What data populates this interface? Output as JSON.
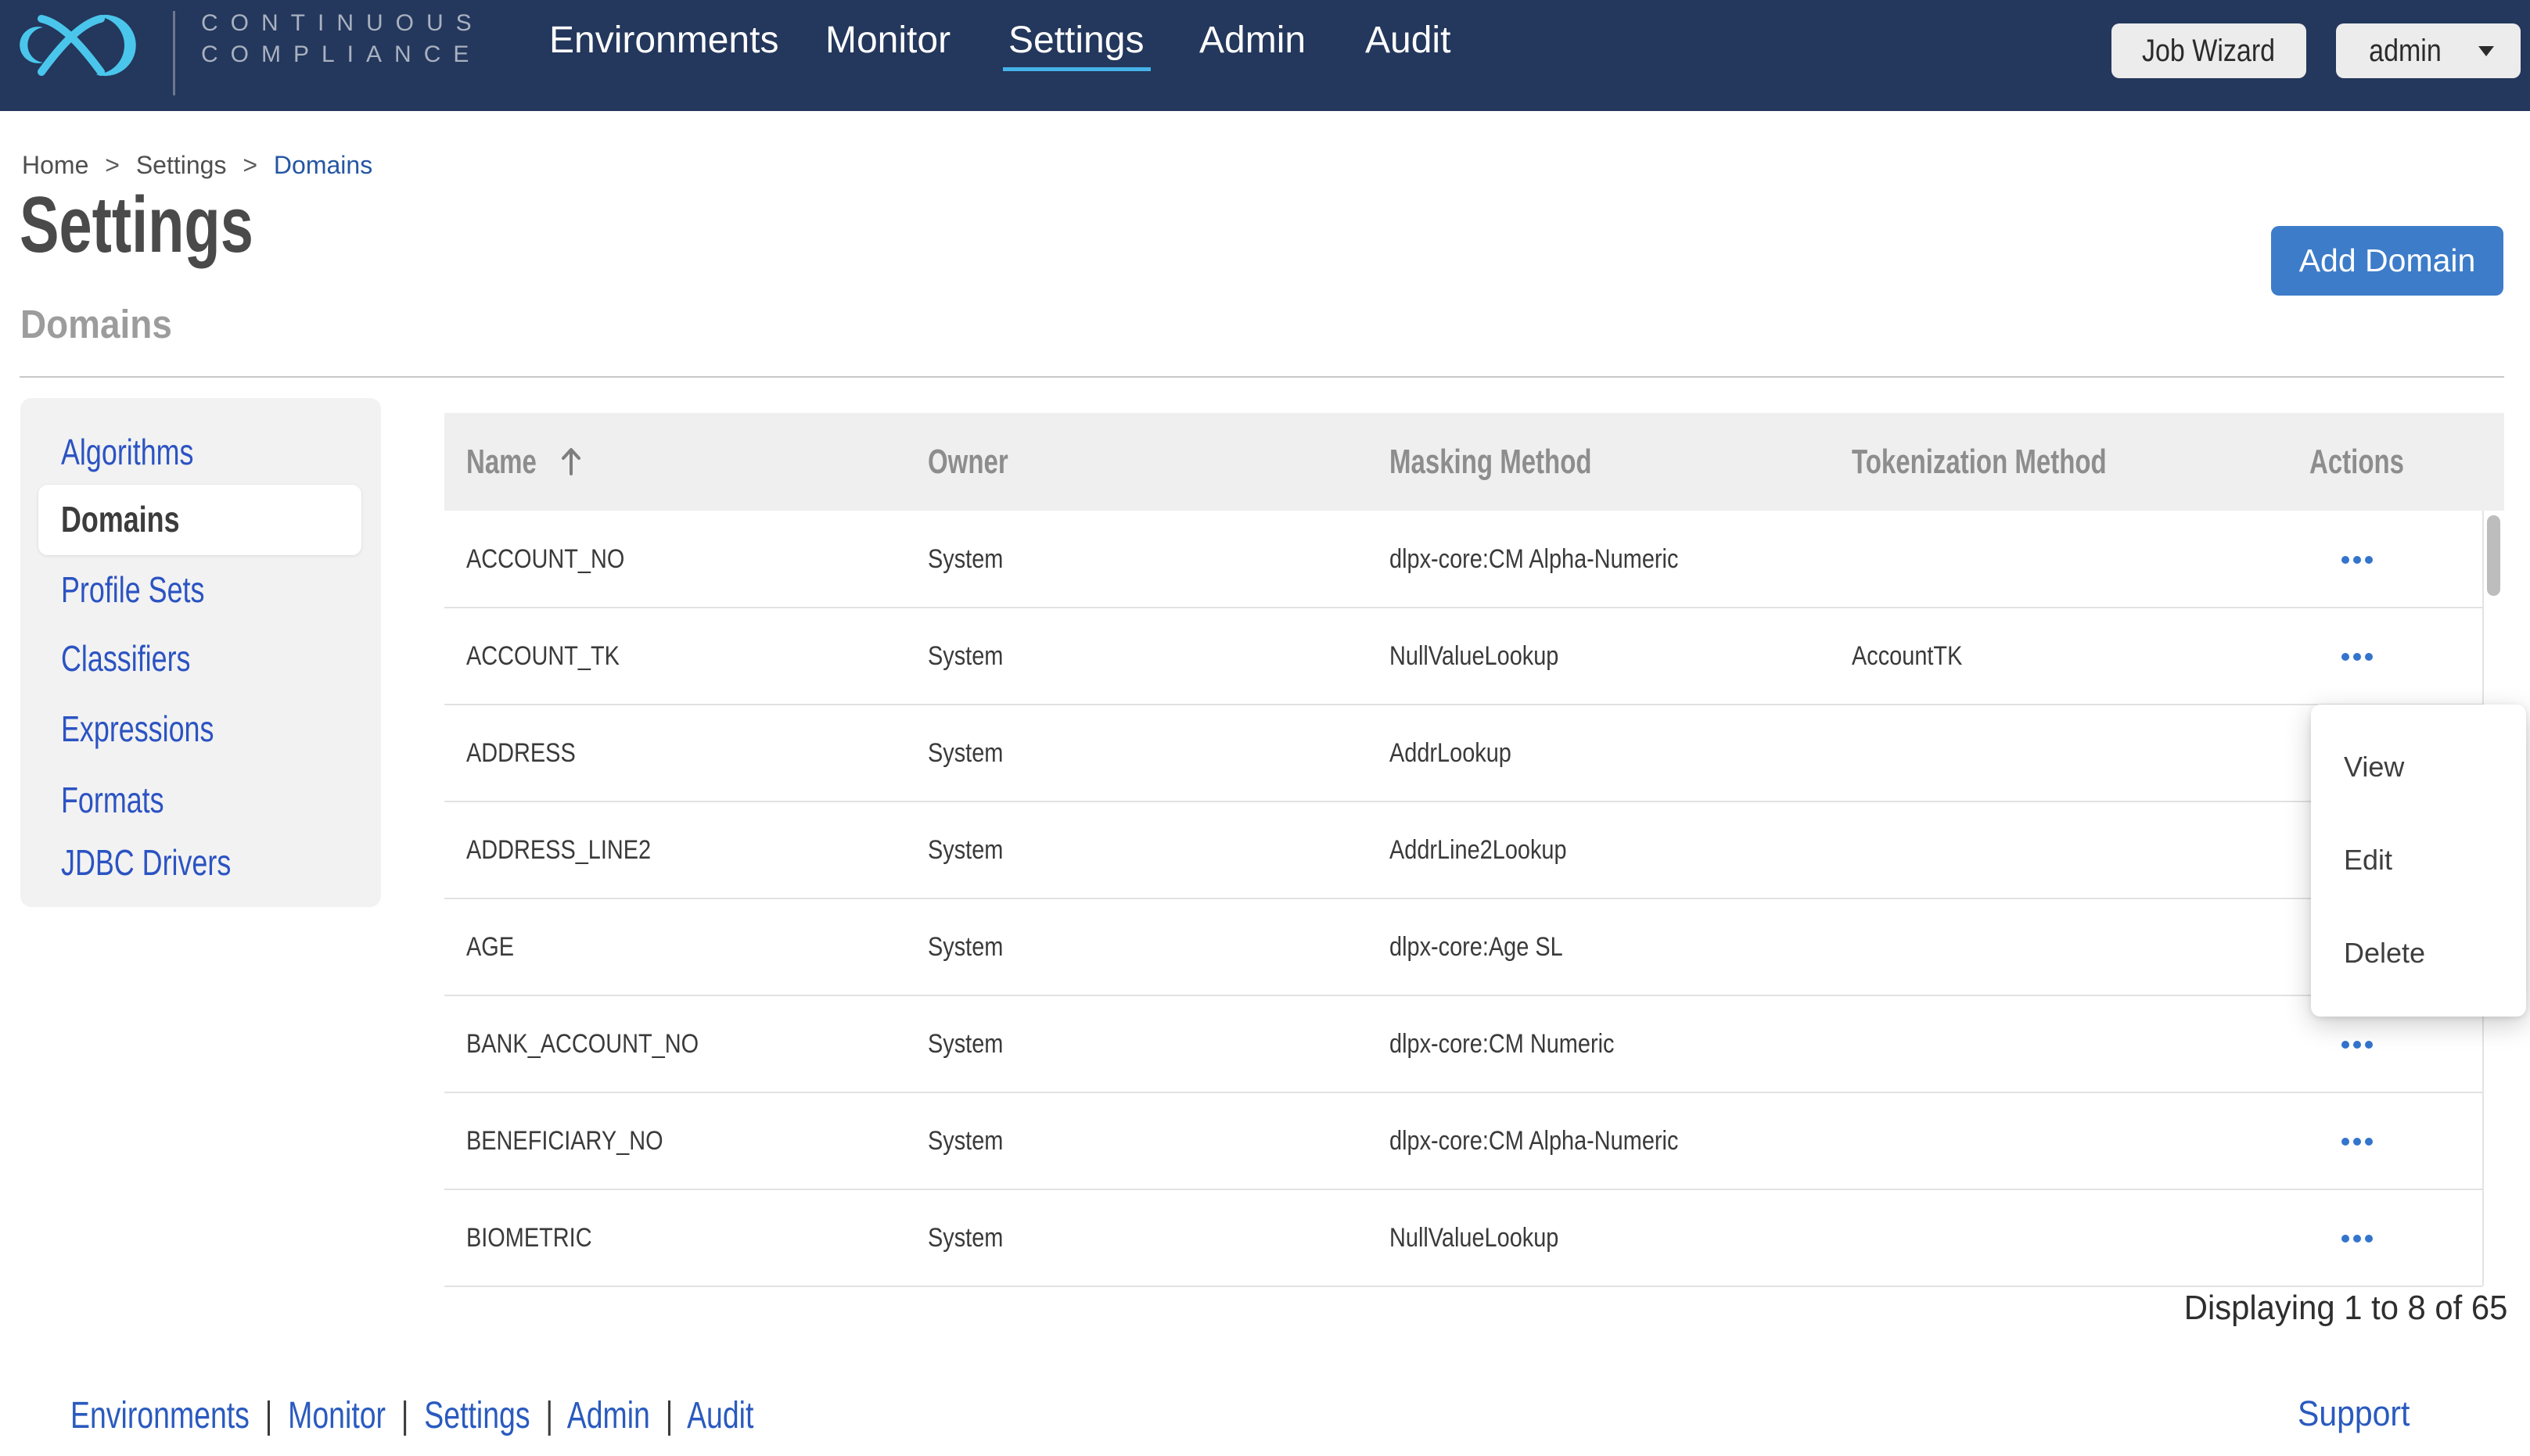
{
  "brand": {
    "logo_icon": "delphix-mark",
    "line1": "CONTINUOUS",
    "line2": "COMPLIANCE"
  },
  "topbar": {
    "nav": [
      {
        "label": "Environments",
        "active": false
      },
      {
        "label": "Monitor",
        "active": false
      },
      {
        "label": "Settings",
        "active": true
      },
      {
        "label": "Admin",
        "active": false
      },
      {
        "label": "Audit",
        "active": false
      }
    ],
    "job_wizard_label": "Job Wizard",
    "user_menu_label": "admin"
  },
  "breadcrumb": {
    "separator": ">",
    "items": [
      {
        "label": "Home",
        "link": false
      },
      {
        "label": "Settings",
        "link": false
      },
      {
        "label": "Domains",
        "link": true
      }
    ]
  },
  "page": {
    "title": "Settings",
    "subtitle": "Domains",
    "add_button_label": "Add Domain"
  },
  "sidebar": {
    "items": [
      {
        "label": "Algorithms",
        "active": false
      },
      {
        "label": "Domains",
        "active": true
      },
      {
        "label": "Profile Sets",
        "active": false
      },
      {
        "label": "Classifiers",
        "active": false
      },
      {
        "label": "Expressions",
        "active": false
      },
      {
        "label": "Formats",
        "active": false
      },
      {
        "label": "JDBC Drivers",
        "active": false
      }
    ]
  },
  "table": {
    "columns": [
      "Name",
      "Owner",
      "Masking Method",
      "Tokenization Method",
      "Actions"
    ],
    "sort": {
      "column": "Name",
      "direction": "ascending",
      "icon": "arrow-up"
    },
    "rows": [
      {
        "name": "ACCOUNT_NO",
        "owner": "System",
        "masking_method": "dlpx-core:CM Alpha-Numeric",
        "tokenization_method": ""
      },
      {
        "name": "ACCOUNT_TK",
        "owner": "System",
        "masking_method": "NullValueLookup",
        "tokenization_method": "AccountTK"
      },
      {
        "name": "ADDRESS",
        "owner": "System",
        "masking_method": "AddrLookup",
        "tokenization_method": ""
      },
      {
        "name": "ADDRESS_LINE2",
        "owner": "System",
        "masking_method": "AddrLine2Lookup",
        "tokenization_method": ""
      },
      {
        "name": "AGE",
        "owner": "System",
        "masking_method": "dlpx-core:Age SL",
        "tokenization_method": ""
      },
      {
        "name": "BANK_ACCOUNT_NO",
        "owner": "System",
        "masking_method": "dlpx-core:CM Numeric",
        "tokenization_method": ""
      },
      {
        "name": "BENEFICIARY_NO",
        "owner": "System",
        "masking_method": "dlpx-core:CM Alpha-Numeric",
        "tokenization_method": ""
      },
      {
        "name": "BIOMETRIC",
        "owner": "System",
        "masking_method": "NullValueLookup",
        "tokenization_method": ""
      }
    ],
    "row_actions_icon": "ellipsis",
    "status": "Displaying 1 to 8 of 65"
  },
  "context_menu": {
    "items": [
      "View",
      "Edit",
      "Delete"
    ]
  },
  "footer": {
    "separator": "|",
    "links": [
      "Environments",
      "Monitor",
      "Settings",
      "Admin",
      "Audit"
    ],
    "support_label": "Support"
  },
  "colors": {
    "topbar_bg": "#24375c",
    "logo_blue": "#4ac6ec",
    "underline_blue": "#45b3e8",
    "accent_button": "#3d7cc9",
    "dots_blue": "#3374cc",
    "sidebar_link": "#2b53c2",
    "breadcrumb_link": "#2456a4",
    "footer_link": "#2a5abf",
    "panel_gray": "#f2f2f2",
    "header_gray": "#efefef"
  }
}
